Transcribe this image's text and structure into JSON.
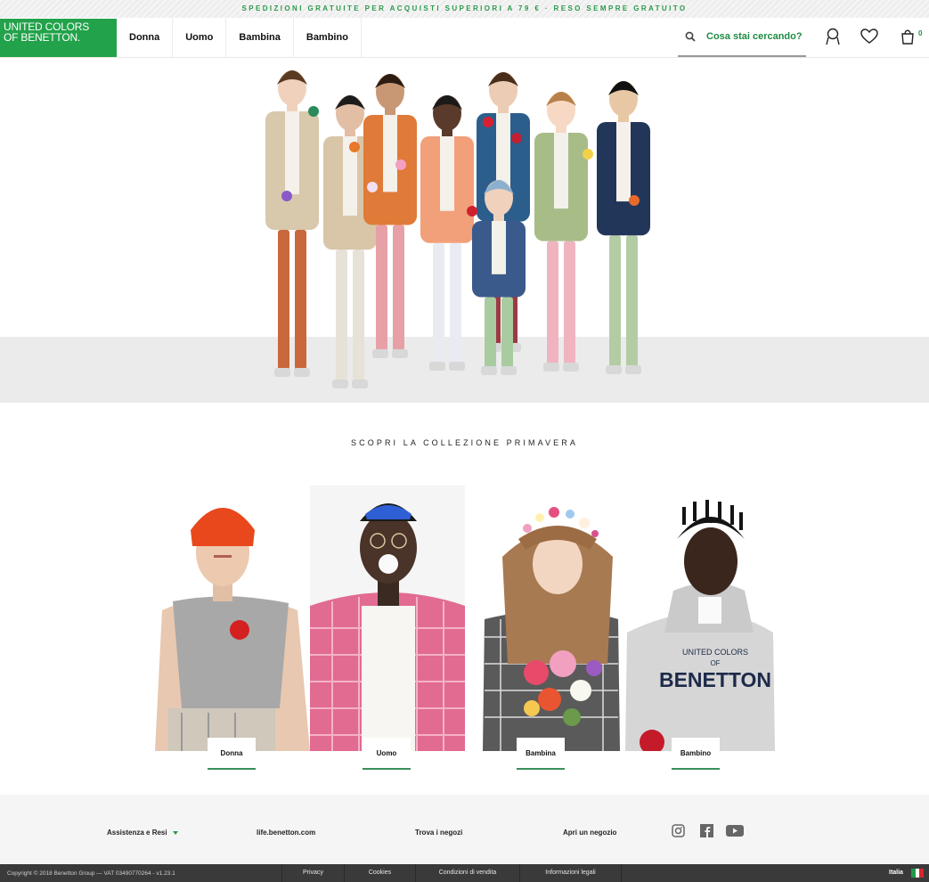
{
  "promo": {
    "text": "SPEDIZIONI GRATUITE PER ACQUISTI SUPERIORI A 79 € · RESO SEMPRE GRATUITO"
  },
  "header": {
    "logo_line1": "UNITED COLORS",
    "logo_line2": "OF BENETTON.",
    "nav": [
      "Donna",
      "Uomo",
      "Bambina",
      "Bambino"
    ],
    "search_placeholder": "Cosa stai cercando?",
    "bag_count": "0",
    "icons": [
      "search-icon",
      "account-icon",
      "heart-icon",
      "bag-icon"
    ]
  },
  "main": {
    "section_title": "SCOPRI LA COLLEZIONE PRIMAVERA",
    "cards": [
      {
        "label": "Donna"
      },
      {
        "label": "Uomo"
      },
      {
        "label": "Bambina"
      },
      {
        "label": "Bambino"
      }
    ],
    "sweatshirt_print": [
      "UNITED COLORS",
      "OF",
      "BENETTON"
    ]
  },
  "footer": {
    "links": [
      "Assistenza e Resi",
      "life.benetton.com",
      "Trova i negozi",
      "Apri un negozio"
    ],
    "social": [
      "instagram-icon",
      "facebook-icon",
      "youtube-icon"
    ],
    "copyright": "Copyright © 2018 Benetton Group — VAT 03490770264 - v1.23.1",
    "bottom_links": [
      "Privacy",
      "Cookies",
      "Condizioni di vendita",
      "Informazioni legali"
    ],
    "country": "Italia"
  },
  "colors": {
    "brand_green": "#22a24a",
    "accent_green": "#1f8c43",
    "dark_bar": "#3a3a3a"
  }
}
